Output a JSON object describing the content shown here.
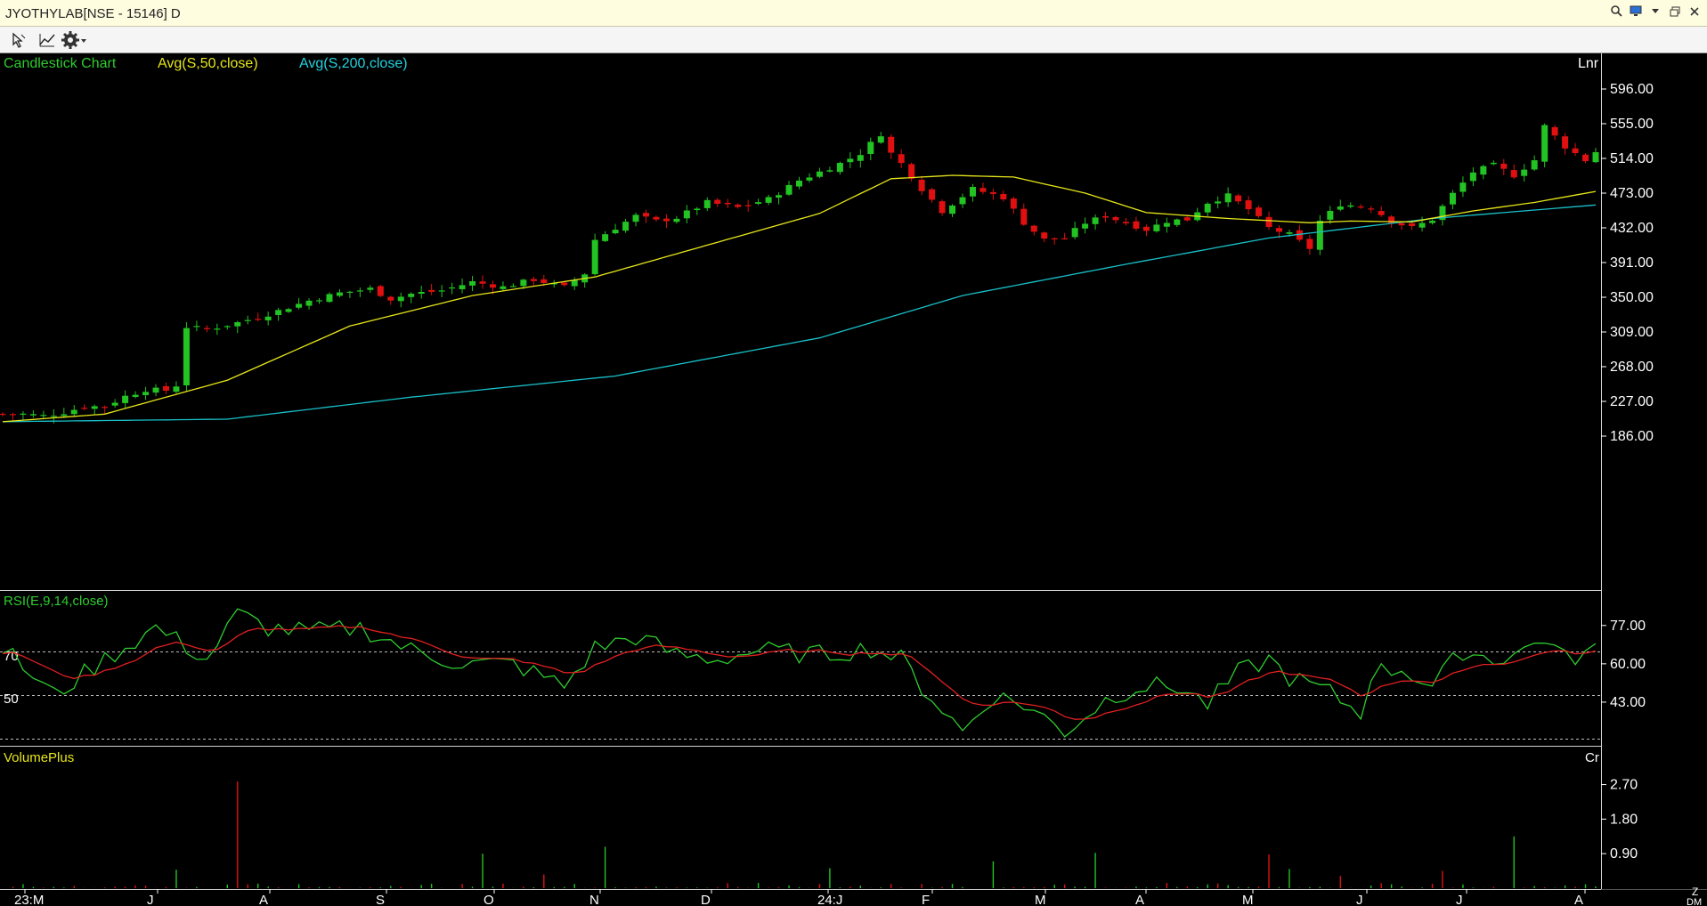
{
  "window": {
    "title": "JYOTHYLAB[NSE - 15146] D",
    "controls": [
      "search-icon",
      "screen-icon",
      "dropdown-icon",
      "restore-icon",
      "close-icon"
    ]
  },
  "toolbar": {
    "icons": [
      "cursor-icon",
      "chart-type-icon",
      "settings-icon"
    ]
  },
  "colors": {
    "background": "#000000",
    "up_candle": "#22c322",
    "down_candle": "#e01010",
    "sma50": "#e6e61a",
    "sma200": "#18c0c8",
    "rsi": "#2ecc2e",
    "rsi_signal": "#e02020",
    "legend_candle": "#2ecc2e",
    "legend_sma50": "#e6e61a",
    "legend_sma200": "#22d3e0",
    "axis_text": "#ffffff"
  },
  "panels": {
    "price": {
      "legend": [
        "Candlestick Chart",
        "Avg(S,50,close)",
        "Avg(S,200,close)"
      ],
      "scale_label": "Lnr"
    },
    "rsi": {
      "legend": "RSI(E,9,14,close)",
      "level_labels": [
        "70",
        "50"
      ]
    },
    "volume": {
      "legend": "VolumePlus",
      "scale_label": "Cr"
    }
  },
  "x_axis": {
    "labels": [
      "23:M",
      "J",
      "A",
      "S",
      "O",
      "N",
      "D",
      "24:J",
      "F",
      "M",
      "A",
      "M",
      "J",
      "J",
      "A"
    ]
  },
  "corner_labels": [
    "Z",
    "DM"
  ],
  "chart_data": [
    {
      "type": "candlestick",
      "title": "Candlestick Chart",
      "ylim": [
        186,
        596
      ],
      "y_ticks": [
        "596.00",
        "555.00",
        "514.00",
        "473.00",
        "432.00",
        "391.00",
        "350.00",
        "309.00",
        "268.00",
        "227.00",
        "186.00"
      ],
      "x_labels": [
        "23:M",
        "J",
        "A",
        "S",
        "O",
        "N",
        "D",
        "24:J",
        "F",
        "M",
        "A",
        "M",
        "J",
        "J",
        "A"
      ],
      "close_waypoints": [
        [
          0,
          212
        ],
        [
          2,
          212
        ],
        [
          4,
          210
        ],
        [
          6,
          214
        ],
        [
          8,
          221
        ],
        [
          10,
          221
        ],
        [
          12,
          233
        ],
        [
          14,
          241
        ],
        [
          16,
          240
        ],
        [
          17,
          246
        ],
        [
          18,
          315
        ],
        [
          20,
          312
        ],
        [
          23,
          320
        ],
        [
          26,
          330
        ],
        [
          30,
          346
        ],
        [
          33,
          355
        ],
        [
          36,
          360
        ],
        [
          38,
          348
        ],
        [
          40,
          354
        ],
        [
          43,
          358
        ],
        [
          46,
          368
        ],
        [
          49,
          362
        ],
        [
          52,
          371
        ],
        [
          55,
          362
        ],
        [
          57,
          378
        ],
        [
          58,
          418
        ],
        [
          60,
          432
        ],
        [
          62,
          446
        ],
        [
          64,
          440
        ],
        [
          66,
          444
        ],
        [
          69,
          462
        ],
        [
          72,
          456
        ],
        [
          75,
          466
        ],
        [
          78,
          488
        ],
        [
          80,
          498
        ],
        [
          82,
          508
        ],
        [
          84,
          520
        ],
        [
          86,
          543
        ],
        [
          87,
          520
        ],
        [
          88,
          508
        ],
        [
          90,
          478
        ],
        [
          92,
          452
        ],
        [
          95,
          478
        ],
        [
          98,
          468
        ],
        [
          100,
          438
        ],
        [
          102,
          418
        ],
        [
          104,
          420
        ],
        [
          106,
          438
        ],
        [
          108,
          446
        ],
        [
          110,
          438
        ],
        [
          112,
          430
        ],
        [
          114,
          440
        ],
        [
          116,
          442
        ],
        [
          118,
          462
        ],
        [
          120,
          470
        ],
        [
          122,
          454
        ],
        [
          124,
          432
        ],
        [
          126,
          424
        ],
        [
          128,
          408
        ],
        [
          129,
          440
        ],
        [
          131,
          460
        ],
        [
          134,
          456
        ],
        [
          136,
          440
        ],
        [
          138,
          432
        ],
        [
          140,
          442
        ],
        [
          142,
          472
        ],
        [
          144,
          498
        ],
        [
          146,
          506
        ],
        [
          148,
          494
        ],
        [
          150,
          512
        ],
        [
          151,
          552
        ],
        [
          153,
          528
        ],
        [
          155,
          512
        ],
        [
          156,
          522
        ]
      ],
      "sma50_waypoints": [
        [
          0,
          203
        ],
        [
          10,
          212
        ],
        [
          22,
          252
        ],
        [
          34,
          316
        ],
        [
          46,
          352
        ],
        [
          58,
          374
        ],
        [
          70,
          415
        ],
        [
          80,
          449
        ],
        [
          87,
          490
        ],
        [
          93,
          494
        ],
        [
          99,
          492
        ],
        [
          106,
          473
        ],
        [
          112,
          450
        ],
        [
          120,
          443
        ],
        [
          128,
          438
        ],
        [
          132,
          440
        ],
        [
          138,
          439
        ],
        [
          144,
          452
        ],
        [
          150,
          462
        ],
        [
          156,
          475
        ]
      ],
      "sma200_waypoints": [
        [
          0,
          203
        ],
        [
          22,
          206
        ],
        [
          40,
          232
        ],
        [
          60,
          257
        ],
        [
          80,
          302
        ],
        [
          94,
          352
        ],
        [
          110,
          389
        ],
        [
          124,
          420
        ],
        [
          140,
          443
        ],
        [
          156,
          459
        ]
      ]
    },
    {
      "type": "line",
      "title": "RSI(E,9,14,close)",
      "ylim": [
        26,
        86
      ],
      "y_ticks": [
        "77.00",
        "60.00",
        "43.00"
      ],
      "reference_lines": [
        70,
        50,
        30
      ],
      "rsi_waypoints": [
        [
          0,
          67
        ],
        [
          5,
          46
        ],
        [
          10,
          62
        ],
        [
          15,
          76
        ],
        [
          20,
          62
        ],
        [
          23,
          82
        ],
        [
          26,
          76
        ],
        [
          30,
          74
        ],
        [
          35,
          76
        ],
        [
          40,
          66
        ],
        [
          45,
          60
        ],
        [
          50,
          60
        ],
        [
          55,
          50
        ],
        [
          58,
          67
        ],
        [
          62,
          72
        ],
        [
          66,
          64
        ],
        [
          70,
          62
        ],
        [
          74,
          66
        ],
        [
          80,
          64
        ],
        [
          85,
          67
        ],
        [
          88,
          62
        ],
        [
          90,
          50
        ],
        [
          94,
          30
        ],
        [
          97,
          46
        ],
        [
          100,
          42
        ],
        [
          104,
          30
        ],
        [
          108,
          44
        ],
        [
          111,
          50
        ],
        [
          115,
          50
        ],
        [
          118,
          42
        ],
        [
          121,
          56
        ],
        [
          124,
          62
        ],
        [
          126,
          54
        ],
        [
          130,
          47
        ],
        [
          133,
          38
        ],
        [
          134,
          56
        ],
        [
          137,
          58
        ],
        [
          140,
          50
        ],
        [
          143,
          66
        ],
        [
          146,
          62
        ],
        [
          149,
          66
        ],
        [
          151,
          72
        ],
        [
          153,
          62
        ],
        [
          156,
          66
        ]
      ]
    },
    {
      "type": "bar",
      "title": "VolumePlus",
      "ylim": [
        0,
        3.2
      ],
      "y_ticks": [
        "2.70",
        "1.80",
        "0.90"
      ],
      "spikes": [
        [
          23,
          2.78
        ],
        [
          59,
          1.08
        ],
        [
          47,
          0.9
        ],
        [
          81,
          0.52
        ],
        [
          107,
          0.92
        ],
        [
          124,
          0.88
        ],
        [
          148,
          1.35
        ],
        [
          97,
          0.7
        ],
        [
          17,
          0.48
        ],
        [
          53,
          0.36
        ],
        [
          141,
          0.45
        ],
        [
          126,
          0.5
        ],
        [
          131,
          0.32
        ]
      ]
    }
  ]
}
